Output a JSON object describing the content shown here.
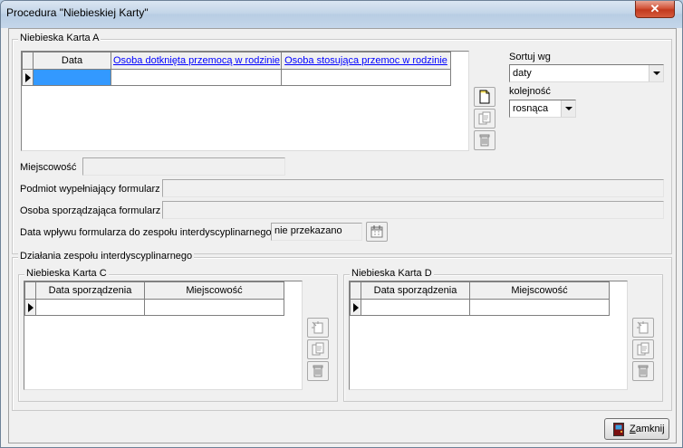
{
  "window": {
    "title": "Procedura \"Niebieskiej Karty\"",
    "close_glyph": "✕"
  },
  "karta_a": {
    "legend": "Niebieska Karta A",
    "columns": [
      "Data",
      "Osoba dotknięta przemocą w rodzinie",
      "Osoba stosująca przemoc w rodzinie"
    ],
    "rows": [
      [
        "",
        "",
        ""
      ]
    ]
  },
  "sort": {
    "label": "Sortuj wg",
    "value": "daty",
    "order_label": "kolejność",
    "order_value": "rosnąca"
  },
  "form": {
    "miejscowosc_label": "Miejscowość",
    "miejscowosc_value": "",
    "podmiot_label": "Podmiot wypełniający formularz",
    "podmiot_value": "",
    "osoba_label": "Osoba sporządzająca formularz",
    "osoba_value": "",
    "data_wplywu_label": "Data wpływu formularza do zespołu interdyscyplinarnego",
    "data_wplywu_value": "nie przekazano"
  },
  "dzialania": {
    "legend": "Działania zespołu interdyscyplinarnego",
    "karta_c": {
      "legend": "Niebieska Karta C",
      "columns": [
        "Data sporządzenia",
        "Miejscowość"
      ],
      "rows": [
        [
          "",
          ""
        ]
      ]
    },
    "karta_d": {
      "legend": "Niebieska Karta D",
      "columns": [
        "Data sporządzenia",
        "Miejscowość"
      ],
      "rows": [
        [
          "",
          ""
        ]
      ]
    }
  },
  "buttons": {
    "close_label": "Zamknij"
  },
  "icons": {
    "new": "new-document-icon",
    "edit": "edit-document-icon",
    "delete": "trash-icon",
    "calendar": "calendar-icon",
    "door": "exit-door-icon"
  },
  "colors": {
    "link": "#0000ff",
    "selection": "#3399ff",
    "titlebar": "#c3d5e8"
  }
}
